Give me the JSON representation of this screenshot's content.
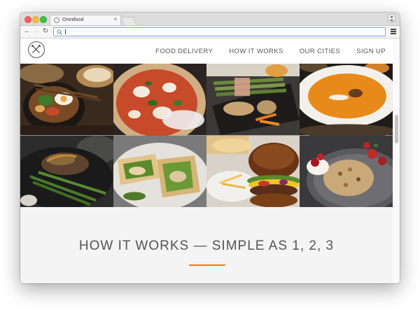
{
  "browser": {
    "tab_title": "Omnifood",
    "tab_close": "×",
    "address_value": "",
    "back_label": "←",
    "forward_label": "→",
    "reload_label": "↻"
  },
  "site": {
    "nav": {
      "items": [
        "FOOD DELIVERY",
        "HOW IT WORKS",
        "OUR CITIES",
        "SIGN UP"
      ]
    },
    "gallery": {
      "tiles": [
        "bibimbap-bowl",
        "margherita-pizza",
        "asparagus-wrap-with-fries",
        "pumpkin-soup",
        "steak-with-green-beans",
        "chicken-salad-wraps",
        "burger-with-fries",
        "granola-with-berries"
      ]
    },
    "how_it_works": {
      "title": "HOW IT WORKS — SIMPLE AS 1, 2, 3"
    }
  },
  "colors": {
    "accent": "#e67e22",
    "section_bg": "#f4f4f4",
    "nav_text": "#555555"
  },
  "scroll": {
    "position_fraction": 0.36
  }
}
